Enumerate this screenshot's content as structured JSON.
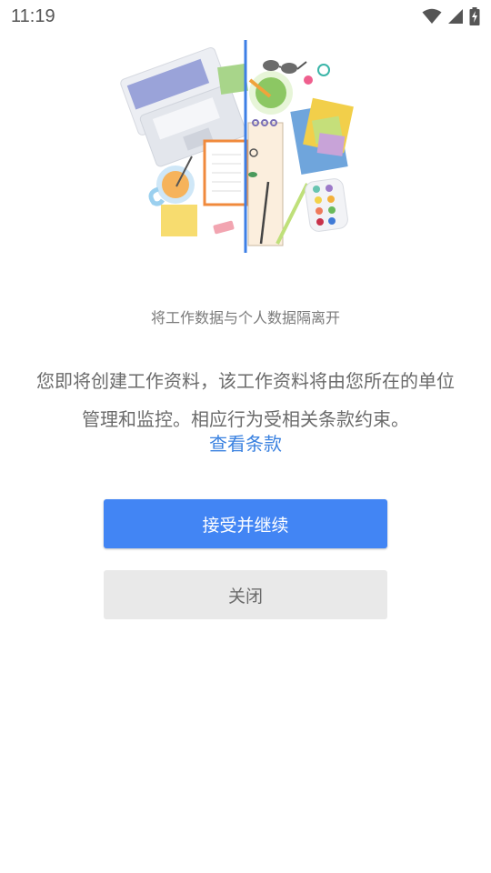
{
  "status_bar": {
    "time": "11:19",
    "icons": [
      "wifi-icon",
      "signal-icon",
      "battery-charging-icon"
    ]
  },
  "main": {
    "subtitle": "将工作数据与个人数据隔离开",
    "description": "您即将创建工作资料，该工作资料将由您所在的单位管理和监控。相应行为受相关条款约束。",
    "terms_link": "查看条款",
    "accept_button": "接受并继续",
    "close_button": "关闭"
  },
  "colors": {
    "accent": "#4285f4",
    "link": "#3b82e0",
    "close_button_bg": "#e9e9e9"
  }
}
